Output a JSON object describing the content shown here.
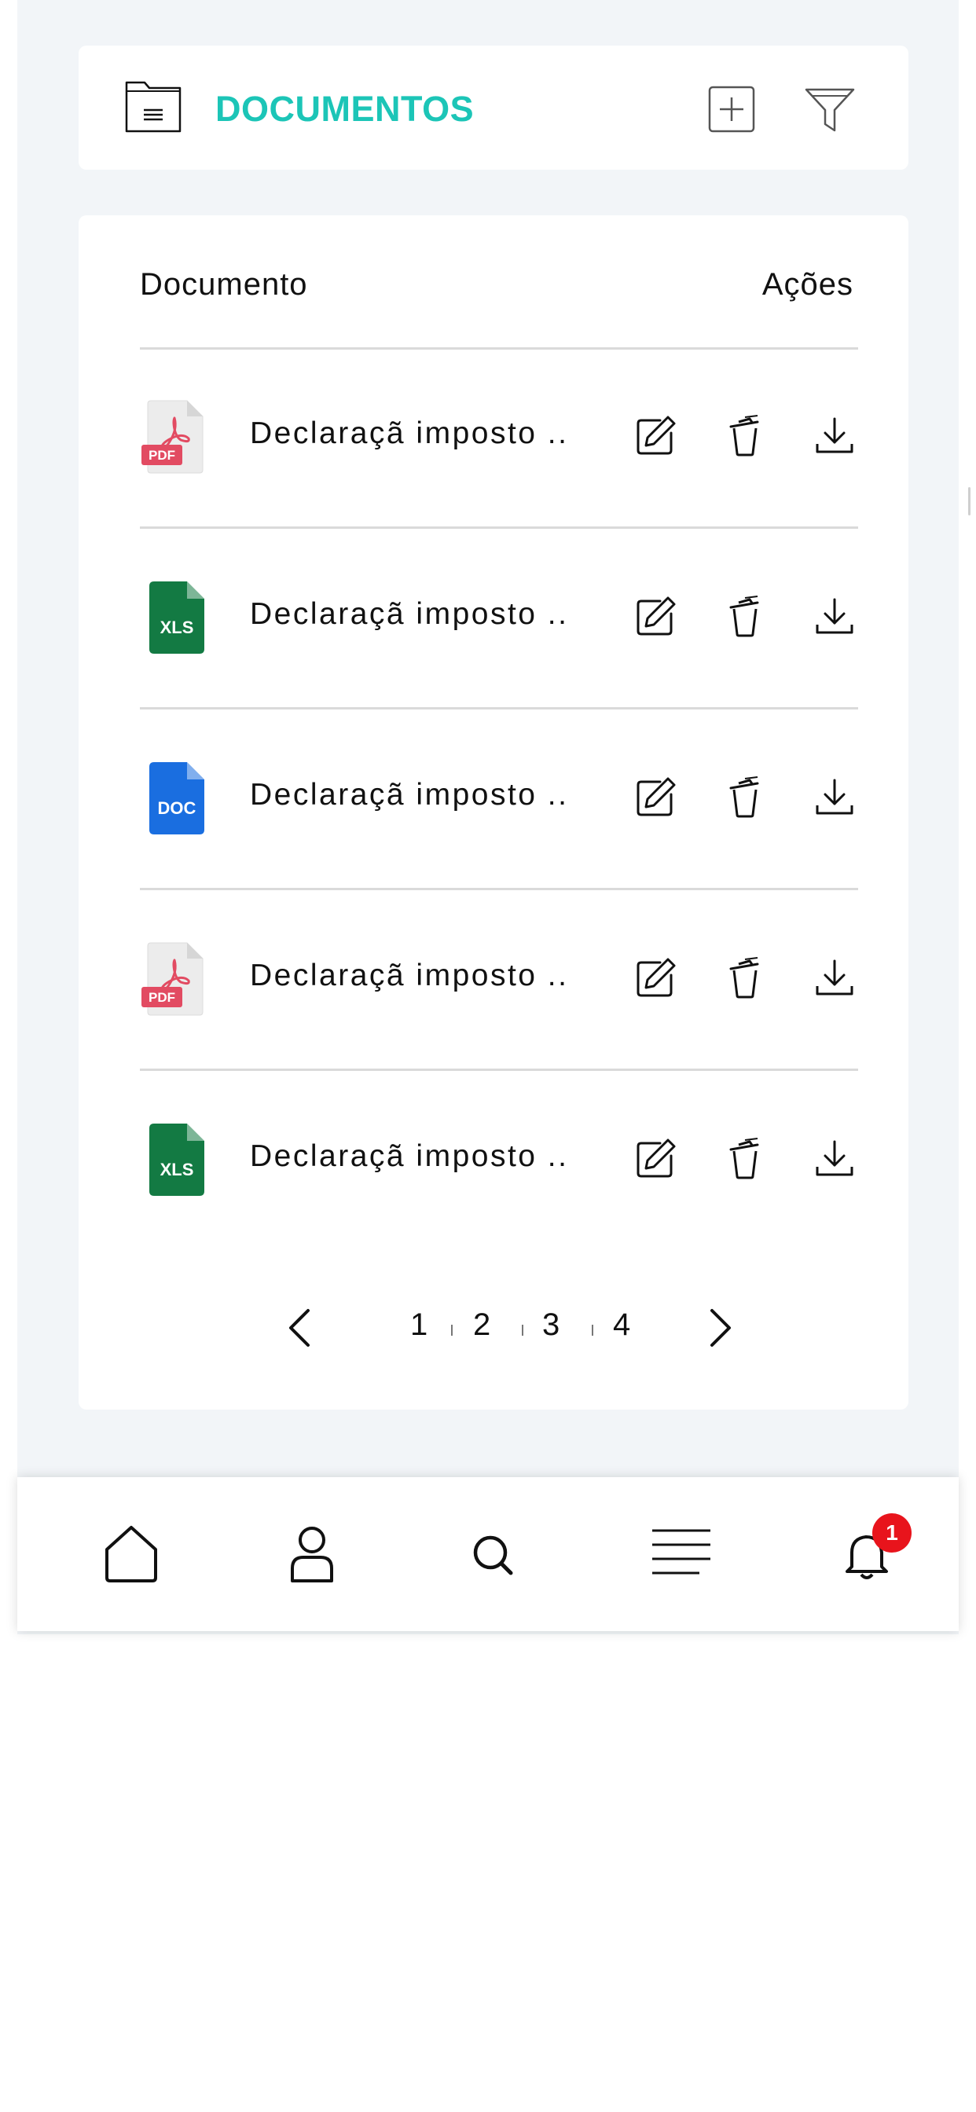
{
  "header": {
    "title": "DOCUMENTOS"
  },
  "table": {
    "col_document": "Documento",
    "col_actions": "Ações",
    "rows": [
      {
        "type": "PDF",
        "name": "Declaraçã imposto .."
      },
      {
        "type": "XLS",
        "name": "Declaraçã imposto .."
      },
      {
        "type": "DOC",
        "name": "Declaraçã imposto .."
      },
      {
        "type": "PDF",
        "name": "Declaraçã imposto .."
      },
      {
        "type": "XLS",
        "name": "Declaraçã imposto .."
      }
    ]
  },
  "pagination": {
    "pages": [
      "1",
      "2",
      "3",
      "4"
    ]
  },
  "bottom_nav": {
    "items": [
      "home-icon",
      "user-icon",
      "search-icon",
      "menu-icon",
      "bell-icon"
    ],
    "notification_count": "1"
  },
  "colors": {
    "accent": "#1cc5b7",
    "pdf": "#e24b62",
    "xls": "#137a43",
    "doc": "#1a6ee0",
    "badge": "#e8141c",
    "background": "#f2f5f8"
  }
}
